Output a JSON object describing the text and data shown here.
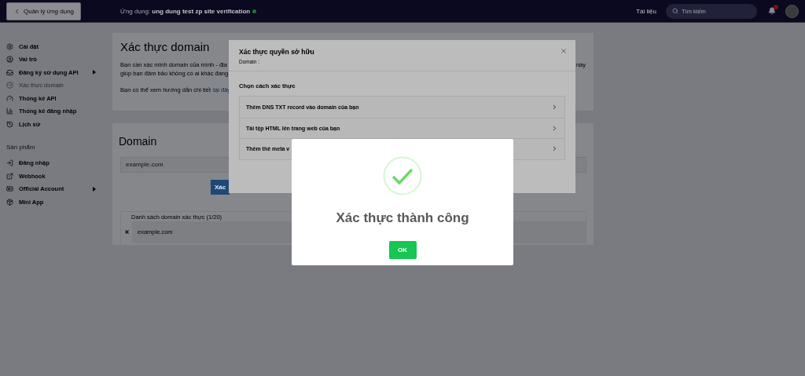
{
  "topbar": {
    "back_button": "Quản lý ứng dụng",
    "app_label": "Ứng dụng: **ung dung test zp site verification**",
    "app_online": true,
    "docs_link": "Tài liệu",
    "search": {
      "placeholder": "Tìm kiếm"
    },
    "notifications_unread": true
  },
  "sidebar": {
    "items": [
      {
        "label": "Cài đặt",
        "selected": false,
        "has_submenu": false
      },
      {
        "label": "Vai trò",
        "selected": false,
        "has_submenu": false
      },
      {
        "label": "Đăng ký sử dụng API",
        "selected": false,
        "has_submenu": true
      },
      {
        "label": "Xác thực domain",
        "selected": true,
        "has_submenu": false
      },
      {
        "label": "Thống kê API",
        "selected": false,
        "has_submenu": false
      },
      {
        "label": "Thống kê đăng nhập",
        "selected": false,
        "has_submenu": false
      },
      {
        "label": "Lịch sử",
        "selected": false,
        "has_submenu": false
      }
    ],
    "section_title": "Sản phẩm",
    "products": [
      {
        "label": "Đăng nhập",
        "selected": false,
        "has_submenu": false
      },
      {
        "label": "Webhook",
        "selected": false,
        "has_submenu": false
      },
      {
        "label": "Official Account",
        "selected": false,
        "has_submenu": true
      },
      {
        "label": "Mini App",
        "selected": false,
        "has_submenu": false
      }
    ]
  },
  "intro_card": {
    "title": "Xác thực domain",
    "line_1": "Bạn cần xác minh domain của mình - địa",
    "line_1_end": "này",
    "line_2": "giúp bạn đảm bảo không có ai khác đang",
    "line_3": "Bạn có thể xem hướng dẫn chi tiết",
    "guide_link": "tại đây"
  },
  "domain_card": {
    "title": "Domain",
    "input": {
      "placeholder": "example.com"
    },
    "verify_button": "Xác",
    "list_title": "Danh sách domain xác thực (1/20)",
    "domains": [
      "example.com"
    ]
  },
  "ownership_dialog": {
    "title": "Xác thực quyền sở hữu",
    "subtitle": "Domain :",
    "prompt": "Chọn cách xác thực",
    "methods": [
      "Thêm DNS TXT record vào domain của bạn",
      "Tải tệp HTML lên trang web của bạn",
      "Thêm thẻ meta v"
    ]
  },
  "success_dialog": {
    "title": "Xác thực thành công",
    "ok_button": "OK"
  }
}
